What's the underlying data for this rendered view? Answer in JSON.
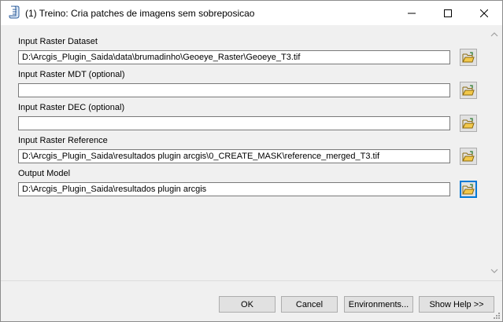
{
  "window": {
    "title": "(1) Treino: Cria patches de imagens sem sobreposicao",
    "icon": "script-tool-icon",
    "controls": [
      "minimize-icon",
      "maximize-icon",
      "close-icon"
    ]
  },
  "parameters": [
    {
      "label": "Input Raster Dataset",
      "value": "D:\\Arcgis_Plugin_Saida\\data\\brumadinho\\Geoeye_Raster\\Geoeye_T3.tif"
    },
    {
      "label": "Input Raster MDT (optional)",
      "value": ""
    },
    {
      "label": "Input Raster DEC (optional)",
      "value": ""
    },
    {
      "label": "Input Raster Reference",
      "value": "D:\\Arcgis_Plugin_Saida\\resultados plugin arcgis\\0_CREATE_MASK\\reference_merged_T3.tif"
    },
    {
      "label": "Output Model",
      "value": "D:\\Arcgis_Plugin_Saida\\resultados plugin arcgis"
    }
  ],
  "buttons": {
    "ok": "OK",
    "cancel": "Cancel",
    "environments": "Environments...",
    "show_help": "Show Help >>"
  },
  "colors": {
    "focus": "#0078d7",
    "folder": "#f2c84b"
  }
}
